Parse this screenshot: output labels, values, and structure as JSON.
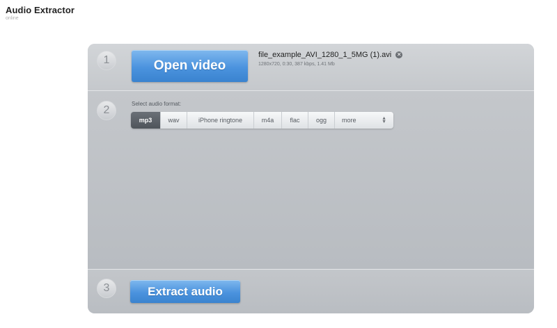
{
  "header": {
    "title": "Audio Extractor",
    "subtitle": "online"
  },
  "steps": {
    "step1": {
      "number": "1",
      "button_label": "Open video",
      "file_name": "file_example_AVI_1280_1_5MG (1).avi",
      "file_meta": "1280x720, 0:30, 387 kbps, 1.41 Mb"
    },
    "step2": {
      "number": "2",
      "label": "Select audio format:",
      "formats": [
        "mp3",
        "wav",
        "iPhone ringtone",
        "m4a",
        "flac",
        "ogg"
      ],
      "selected_format": "mp3",
      "more_label": "more"
    },
    "step3": {
      "number": "3",
      "button_label": "Extract audio"
    }
  },
  "colors": {
    "button_blue": "#4b93de",
    "panel_gray": "#bfc3c8",
    "selected_format": "#5a6066"
  },
  "icons": {
    "remove_file": "close-circle-icon",
    "more_dropdown": "updown-arrows-icon"
  }
}
